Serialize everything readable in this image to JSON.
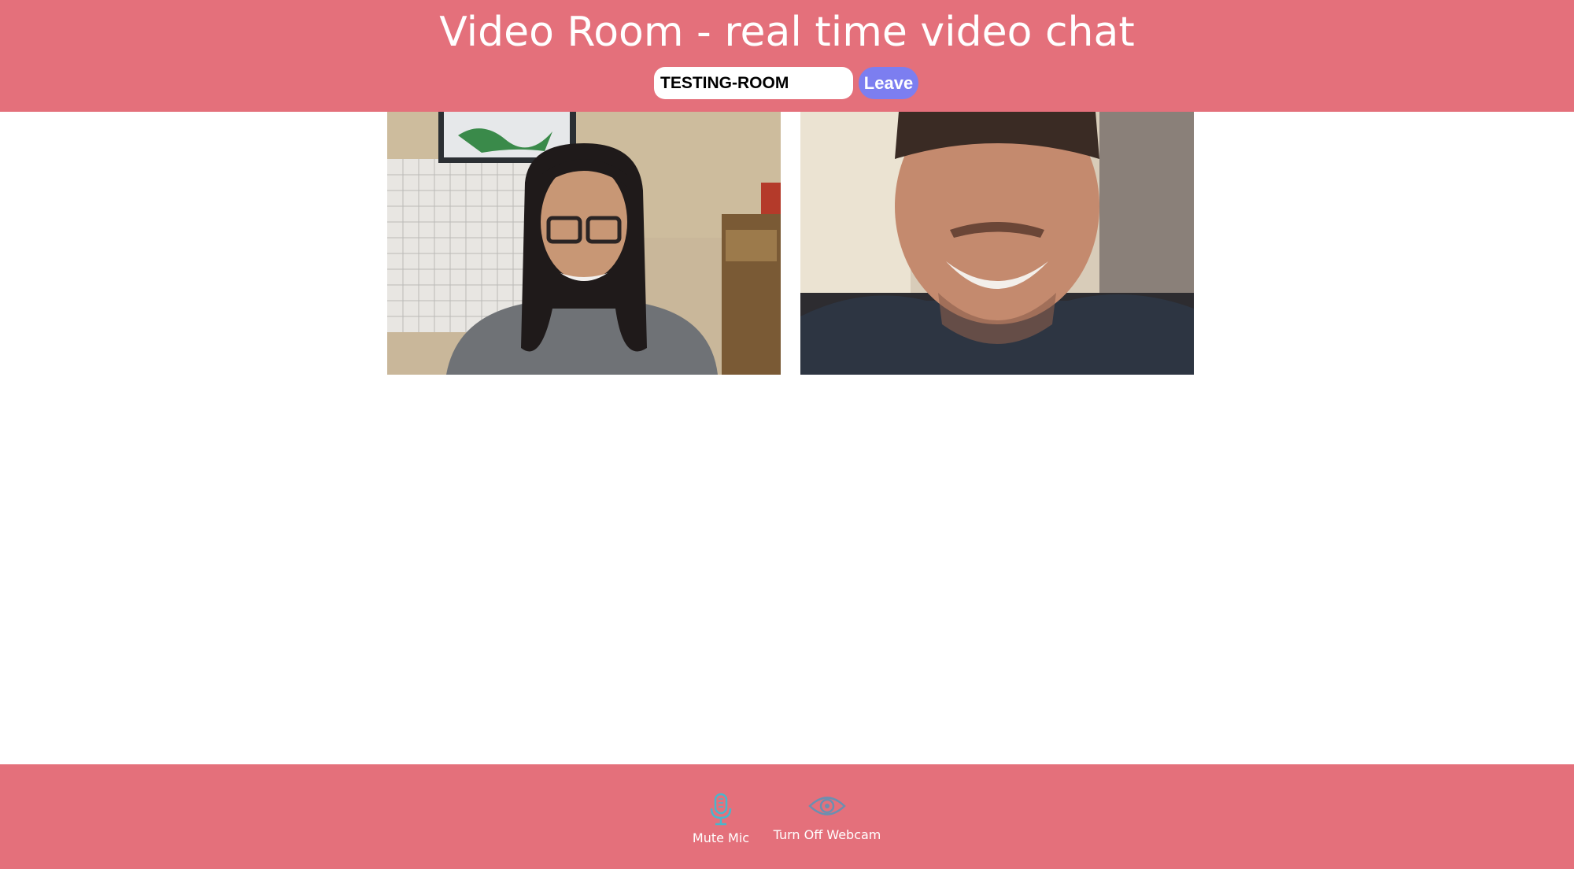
{
  "header": {
    "title": "Video Room - real time video chat",
    "room_input_value": "TESTING-ROOM",
    "leave_label": "Leave"
  },
  "videos": [
    {
      "participant": "participant-1"
    },
    {
      "participant": "participant-2"
    }
  ],
  "controls": {
    "mute_mic_label": "Mute Mic",
    "mute_mic_icon": "microphone-icon",
    "webcam_label": "Turn Off Webcam",
    "webcam_icon": "eye-icon"
  },
  "colors": {
    "bar": "#e4707b",
    "leave_button": "#7c7ef0",
    "icon": "#49b6cc"
  }
}
